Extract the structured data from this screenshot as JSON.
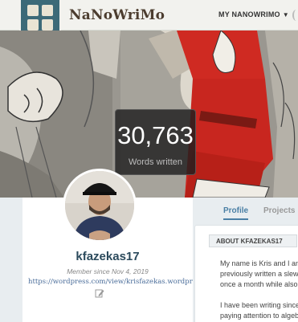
{
  "nav": {
    "brand": "NaNoWriMo",
    "menu_label": "MY NANOWRIMO",
    "menu_caret": "▼"
  },
  "hero": {
    "stat_value": "30,763",
    "stat_label": "Words written"
  },
  "profile": {
    "username": "kfazekas17",
    "member_since": "Member since Nov 4, 2019",
    "website": "https://wordpress.com/view/krisfazekas.wordpress.com"
  },
  "tabs": [
    {
      "label": "Profile",
      "active": true
    },
    {
      "label": "Projects",
      "active": false
    }
  ],
  "about": {
    "heading": "ABOUT KFAZEKAS17",
    "lines": [
      "My name is Kris and I am",
      "previously written a slew",
      "once a month while also",
      "I have been writing since",
      "paying attention to algeb"
    ]
  },
  "colors": {
    "brand_text": "#4c3d2f",
    "link": "#4a6d9a",
    "username": "#2b4a5c",
    "tab_active": "#4a7fa5"
  }
}
